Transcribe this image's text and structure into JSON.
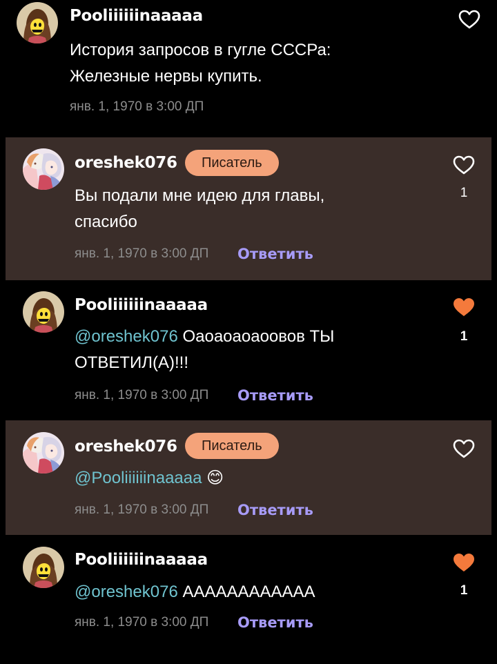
{
  "colors": {
    "background": "#000000",
    "reply_background": "#3a2d29",
    "badge": "#f4a37a",
    "mention": "#6fc3cf",
    "reply_action": "#a79bf7",
    "liked_heart": "#f47a3c",
    "meta": "#8d8d8d"
  },
  "comments": [
    {
      "username": "Pooliiiiiinaaaaa",
      "avatar_icon": "yellow-character-avatar",
      "text_line1": "История запросов в гугле СССРа:",
      "text_line2": "Железные нервы купить.",
      "timestamp": "янв. 1, 1970 в 3:00 ДП",
      "liked": false
    },
    {
      "username": "oreshek076",
      "avatar_icon": "anime-couple-avatar",
      "badge": "Писатель",
      "text_line1": "Вы подали мне идею для главы,",
      "text_line2": "спасибо",
      "timestamp": "янв. 1, 1970 в 3:00 ДП",
      "reply_label": "Ответить",
      "like_count": "1",
      "liked": false
    },
    {
      "username": "Pooliiiiiinaaaaa",
      "avatar_icon": "yellow-character-avatar",
      "mention": "@oreshek076",
      "text_line1": " Оаоаоаоаоовов ТЫ",
      "text_line2": "ОТВЕТИЛ(А)!!!",
      "timestamp": "янв. 1, 1970 в 3:00 ДП",
      "reply_label": "Ответить",
      "like_count": "1",
      "liked": true
    },
    {
      "username": "oreshek076",
      "avatar_icon": "anime-couple-avatar",
      "badge": "Писатель",
      "mention": "@Pooliiiiiinaaaaa",
      "emoji": "😊",
      "timestamp": "янв. 1, 1970 в 3:00 ДП",
      "reply_label": "Ответить",
      "liked": false
    },
    {
      "username": "Pooliiiiiinaaaaa",
      "avatar_icon": "yellow-character-avatar",
      "mention": "@oreshek076",
      "text_line1": " АААААААААААА",
      "timestamp": "янв. 1, 1970 в 3:00 ДП",
      "reply_label": "Ответить",
      "like_count": "1",
      "liked": true
    }
  ]
}
